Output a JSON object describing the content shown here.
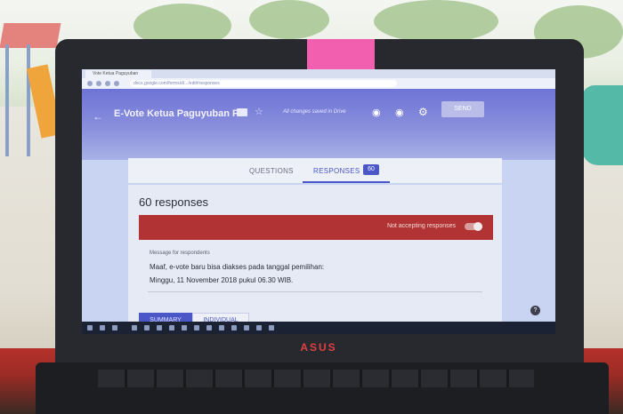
{
  "browser": {
    "tab_title": "Vote Ketua Paguyuban",
    "url": "docs.google.com/forms/d/.../edit#responses"
  },
  "form": {
    "title": "E-Vote Ketua Paguyuban F",
    "saved_status": "All changes saved in Drive",
    "send_label": "SEND"
  },
  "tabs": {
    "questions": "QUESTIONS",
    "responses": "RESPONSES",
    "responses_count": "60"
  },
  "responses": {
    "heading": "60 responses",
    "not_accepting_label": "Not accepting responses",
    "accepting": false,
    "message_label": "Message for respondents",
    "message_line1": "Maaf, e-vote baru bisa diakses pada tanggal pemilihan:",
    "message_line2": "Minggu, 11 November 2018 pukul 06.30 WIB."
  },
  "view_toggle": {
    "summary": "SUMMARY",
    "individual": "INDIVIDUAL",
    "selected": "summary"
  },
  "laptop": {
    "brand": "ASUS"
  },
  "colors": {
    "header_purple": "#6d74d6",
    "accent_indigo": "#4b57c6",
    "banner_red": "#b23333",
    "sticky_note_pink": "#f25fae"
  }
}
